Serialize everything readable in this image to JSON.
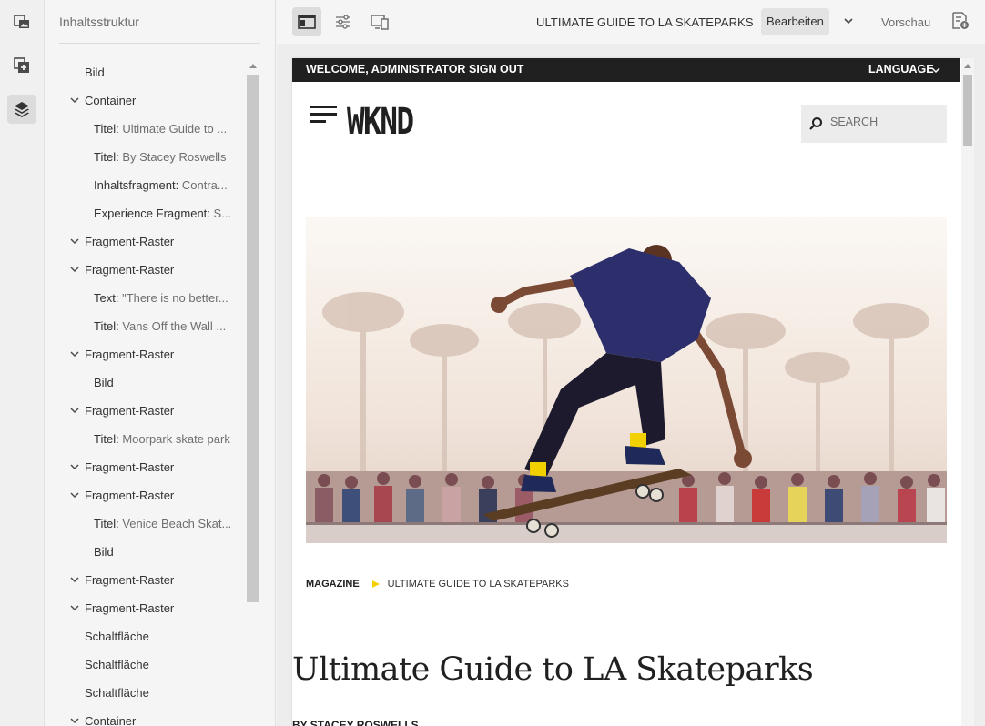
{
  "tree": {
    "title": "Inhaltsstruktur",
    "nodes": [
      {
        "level": 1,
        "expandable": false,
        "type": "Bild",
        "detail": ""
      },
      {
        "level": 1,
        "expandable": true,
        "type": "Container",
        "detail": ""
      },
      {
        "level": 2,
        "expandable": false,
        "type": "Titel:",
        "detail": "Ultimate Guide to ..."
      },
      {
        "level": 2,
        "expandable": false,
        "type": "Titel:",
        "detail": "By Stacey Roswells"
      },
      {
        "level": 2,
        "expandable": false,
        "type": "Inhaltsfragment:",
        "detail": "Contra..."
      },
      {
        "level": 2,
        "expandable": false,
        "type": "Experience Fragment:",
        "detail": "S..."
      },
      {
        "level": 1,
        "expandable": true,
        "type": "Fragment-Raster",
        "detail": ""
      },
      {
        "level": 1,
        "expandable": true,
        "type": "Fragment-Raster",
        "detail": ""
      },
      {
        "level": 2,
        "expandable": false,
        "type": "Text:",
        "detail": "\"There is no better..."
      },
      {
        "level": 2,
        "expandable": false,
        "type": "Titel:",
        "detail": "Vans Off the Wall ..."
      },
      {
        "level": 1,
        "expandable": true,
        "type": "Fragment-Raster",
        "detail": ""
      },
      {
        "level": 2,
        "expandable": false,
        "type": "Bild",
        "detail": ""
      },
      {
        "level": 1,
        "expandable": true,
        "type": "Fragment-Raster",
        "detail": ""
      },
      {
        "level": 2,
        "expandable": false,
        "type": "Titel:",
        "detail": "Moorpark skate park"
      },
      {
        "level": 1,
        "expandable": true,
        "type": "Fragment-Raster",
        "detail": ""
      },
      {
        "level": 1,
        "expandable": true,
        "type": "Fragment-Raster",
        "detail": ""
      },
      {
        "level": 2,
        "expandable": false,
        "type": "Titel:",
        "detail": "Venice Beach Skat..."
      },
      {
        "level": 2,
        "expandable": false,
        "type": "Bild",
        "detail": ""
      },
      {
        "level": 1,
        "expandable": true,
        "type": "Fragment-Raster",
        "detail": ""
      },
      {
        "level": 1,
        "expandable": true,
        "type": "Fragment-Raster",
        "detail": ""
      },
      {
        "level": 1,
        "expandable": false,
        "type": "Schaltfläche",
        "detail": ""
      },
      {
        "level": 1,
        "expandable": false,
        "type": "Schaltfläche",
        "detail": ""
      },
      {
        "level": 1,
        "expandable": false,
        "type": "Schaltfläche",
        "detail": ""
      },
      {
        "level": 1,
        "expandable": true,
        "type": "Container",
        "detail": ""
      }
    ]
  },
  "toolbar": {
    "page_title": "ULTIMATE GUIDE TO LA SKATEPARKS",
    "mode_label": "Bearbeiten",
    "preview_label": "Vorschau"
  },
  "site": {
    "welcome": "WELCOME, ADMINISTRATOR",
    "sign_out": "SIGN OUT",
    "language": "LANGUAGE",
    "logo": "WKND",
    "search_placeholder": "SEARCH",
    "breadcrumb": [
      "MAGAZINE",
      "ULTIMATE GUIDE TO LA SKATEPARKS"
    ],
    "article_title": "Ultimate Guide to LA Skateparks",
    "byline": "BY STACEY ROSWELLS"
  },
  "icons": {
    "rail": [
      "page-assets-icon",
      "components-icon",
      "content-tree-icon"
    ],
    "toolbar": [
      "side-panel-toggle-icon",
      "properties-icon",
      "emulator-icon",
      "page-information-icon"
    ]
  },
  "colors": {
    "accent_yellow": "#f5d000",
    "topbar": "#202020"
  }
}
